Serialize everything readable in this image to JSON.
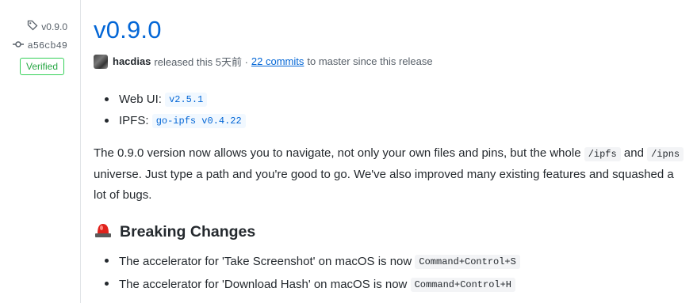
{
  "sidebar": {
    "tag_label": "v0.9.0",
    "commit_sha": "a56cb49",
    "verified_label": "Verified"
  },
  "release": {
    "title": "v0.9.0",
    "author": "hacdias",
    "released_text": "released this 5天前 ·",
    "commits_link": "22 commits",
    "since_text": "to master since this release",
    "versions": [
      {
        "label": "Web UI:",
        "code": "v2.5.1"
      },
      {
        "label": "IPFS:",
        "code": "go-ipfs v0.4.22"
      }
    ],
    "paragraph": {
      "part1": "The 0.9.0 version now allows you to navigate, not only your own files and pins, but the whole",
      "code1": "/ipfs",
      "part2": "and",
      "code2": "/ipns",
      "part3": "universe. Just type a path and you're good to go. We've also improved many existing features and squashed a lot of bugs."
    },
    "breaking_heading": "Breaking Changes",
    "breaking_changes": [
      {
        "text": "The accelerator for 'Take Screenshot' on macOS is now",
        "code": "Command+Control+S"
      },
      {
        "text": "The accelerator for 'Download Hash' on macOS is now",
        "code": "Command+Control+H"
      }
    ]
  },
  "icons": {
    "tag": "tag-icon",
    "commit": "git-commit-icon",
    "siren": "rotating-light-emoji-icon"
  },
  "colors": {
    "link": "#0366d6",
    "verified": "#28a745",
    "siren": "#e0231c"
  }
}
